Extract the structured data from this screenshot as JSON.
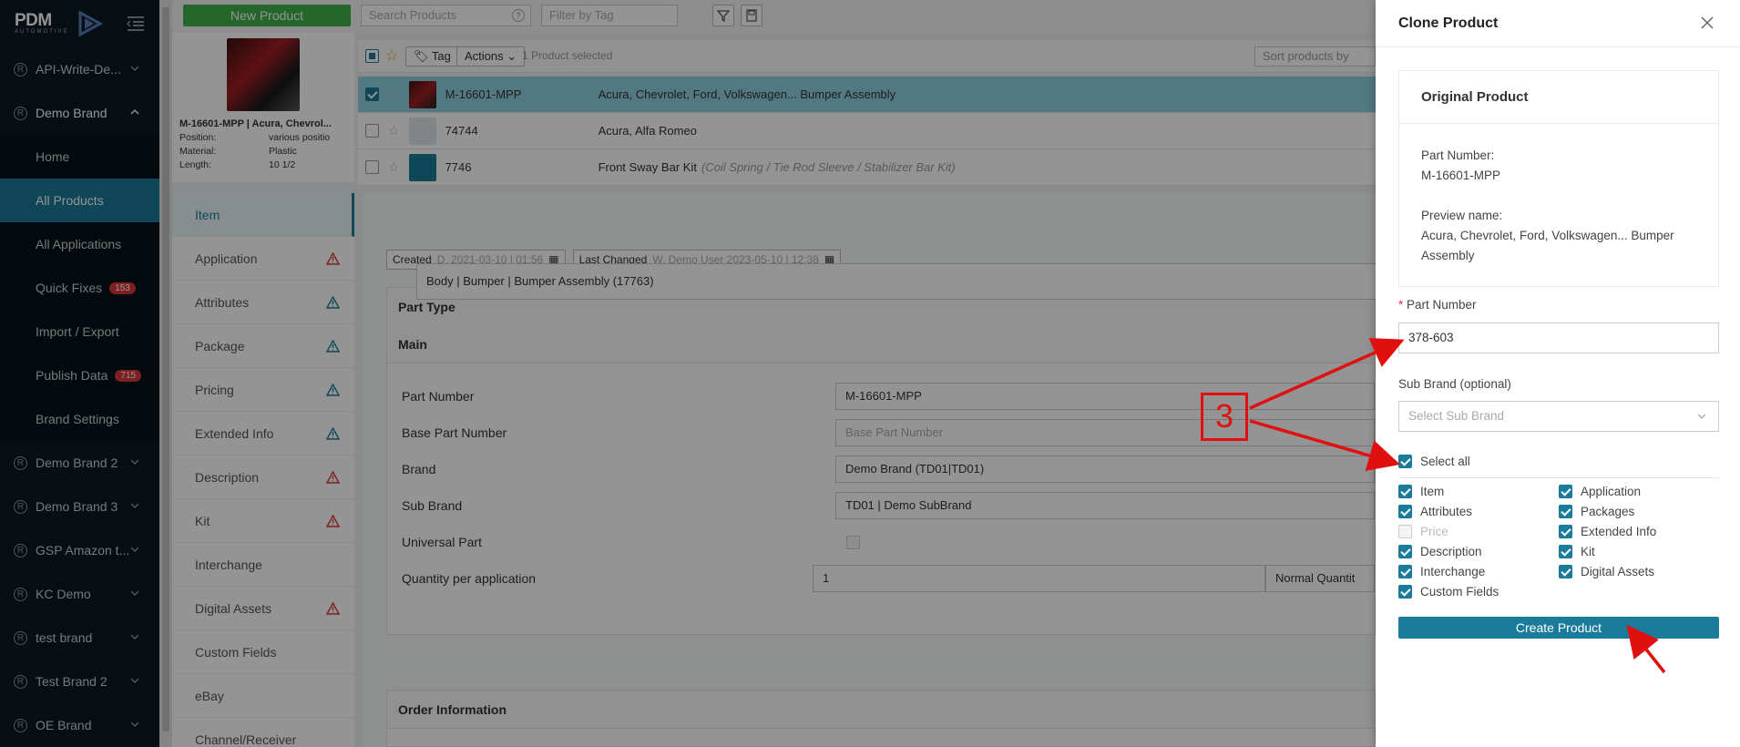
{
  "sidebar": {
    "logo": "PDM",
    "logo_sub": "AUTOMOTIVE",
    "brands_top": [
      {
        "label": "API-Write-De...",
        "r": "R"
      },
      {
        "label": "Demo Brand",
        "r": "R"
      }
    ],
    "demo_items": [
      {
        "label": "Home"
      },
      {
        "label": "All Products"
      },
      {
        "label": "All Applications"
      },
      {
        "label": "Quick Fixes",
        "badge": "153"
      },
      {
        "label": "Import / Export"
      },
      {
        "label": "Publish Data",
        "badge": "715"
      },
      {
        "label": "Brand Settings"
      }
    ],
    "brands_bottom": [
      {
        "label": "Demo Brand 2",
        "r": "R"
      },
      {
        "label": "Demo Brand 3",
        "r": "R"
      },
      {
        "label": "GSP Amazon t...",
        "r": "R"
      },
      {
        "label": "KC Demo",
        "r": "R"
      },
      {
        "label": "test brand",
        "r": "R"
      },
      {
        "label": "Test Brand 2",
        "r": "R"
      },
      {
        "label": "OE Brand",
        "r": "R"
      }
    ]
  },
  "toolbar": {
    "new_product": "New Product",
    "search_placeholder": "Search Products",
    "search_help": "?",
    "filter_placeholder": "Filter by Tag"
  },
  "product_card": {
    "title": "M-16601-MPP | Acura, Chevrol...",
    "rows": [
      {
        "k": "Position:",
        "v": "various positio"
      },
      {
        "k": "Material:",
        "v": "Plastic"
      },
      {
        "k": "Length:",
        "v": "10 1/2"
      }
    ]
  },
  "list": {
    "tag": "Tag",
    "actions": "Actions",
    "selected": "1 Product selected",
    "sort_placeholder": "Sort products by",
    "rows": [
      {
        "pn": "M-16601-MPP",
        "desc": "Acura, Chevrolet, Ford, Volkswagen... Bumper Assembly",
        "extra": ""
      },
      {
        "pn": "74744",
        "desc": "Acura, Alfa Romeo",
        "extra": ""
      },
      {
        "pn": "7746",
        "desc": "Front Sway Bar Kit",
        "extra": "(Coil Spring / Tie Rod Sleeve / Stabilizer Bar Kit)"
      }
    ]
  },
  "nav_tabs": [
    {
      "label": "Item",
      "warn": ""
    },
    {
      "label": "Application",
      "warn": "red"
    },
    {
      "label": "Attributes",
      "warn": "blue"
    },
    {
      "label": "Package",
      "warn": "blue"
    },
    {
      "label": "Pricing",
      "warn": "blue"
    },
    {
      "label": "Extended Info",
      "warn": "blue"
    },
    {
      "label": "Description",
      "warn": "red"
    },
    {
      "label": "Kit",
      "warn": "red"
    },
    {
      "label": "Interchange",
      "warn": ""
    },
    {
      "label": "Digital Assets",
      "warn": "red"
    },
    {
      "label": "Custom Fields",
      "warn": ""
    },
    {
      "label": "eBay",
      "warn": ""
    },
    {
      "label": "Channel/Receiver",
      "warn": ""
    }
  ],
  "content": {
    "created_label": "Created",
    "created_value": "D. 2021-03-10 | 01:56",
    "changed_label": "Last Changed",
    "changed_value": "W. Demo User 2023-05-10 | 12:38",
    "part_type_hdr": "Part Type",
    "part_type_value": "Body | Bumper | Bumper Assembly (17763)",
    "main_hdr": "Main",
    "fields": [
      {
        "label": "Part Number",
        "value": "M-16601-MPP",
        "ph": false
      },
      {
        "label": "Base Part Number",
        "value": "Base Part Number",
        "ph": true
      },
      {
        "label": "Brand",
        "value": "Demo Brand (TD01|TD01)",
        "ph": false
      },
      {
        "label": "Sub Brand",
        "value": "TD01 | Demo SubBrand",
        "ph": false
      }
    ],
    "universal_label": "Universal Part",
    "qty_label": "Quantity per application",
    "qty_value": "1",
    "qty_unit": "Normal Quantit",
    "order_hdr": "Order Information"
  },
  "drawer": {
    "title": "Clone Product",
    "orig_title": "Original Product",
    "pn_label": "Part Number:",
    "pn_value": "M-16601-MPP",
    "preview_label": "Preview name:",
    "preview_value": "Acura, Chevrolet, Ford, Volkswagen... Bumper Assembly",
    "req_mark": "*",
    "part_number_label": "Part Number",
    "part_number_value": "378-603",
    "sub_brand_label": "Sub Brand (optional)",
    "sub_brand_placeholder": "Select Sub Brand",
    "select_all": "Select all",
    "left_checks": [
      {
        "label": "Item",
        "checked": true
      },
      {
        "label": "Attributes",
        "checked": true
      },
      {
        "label": "Price",
        "checked": false
      },
      {
        "label": "Description",
        "checked": true
      },
      {
        "label": "Interchange",
        "checked": true
      },
      {
        "label": "Custom Fields",
        "checked": true
      }
    ],
    "right_checks": [
      {
        "label": "Application",
        "checked": true
      },
      {
        "label": "Packages",
        "checked": true
      },
      {
        "label": "Extended Info",
        "checked": true
      },
      {
        "label": "Kit",
        "checked": true
      },
      {
        "label": "Digital Assets",
        "checked": true
      }
    ],
    "create_button": "Create Product"
  },
  "annotation": {
    "step": "3"
  },
  "colors": {
    "accent": "#1a7b9a",
    "sidebar": "#0f1b24",
    "new_button": "#3fb04a",
    "arrow": "#e01010"
  }
}
